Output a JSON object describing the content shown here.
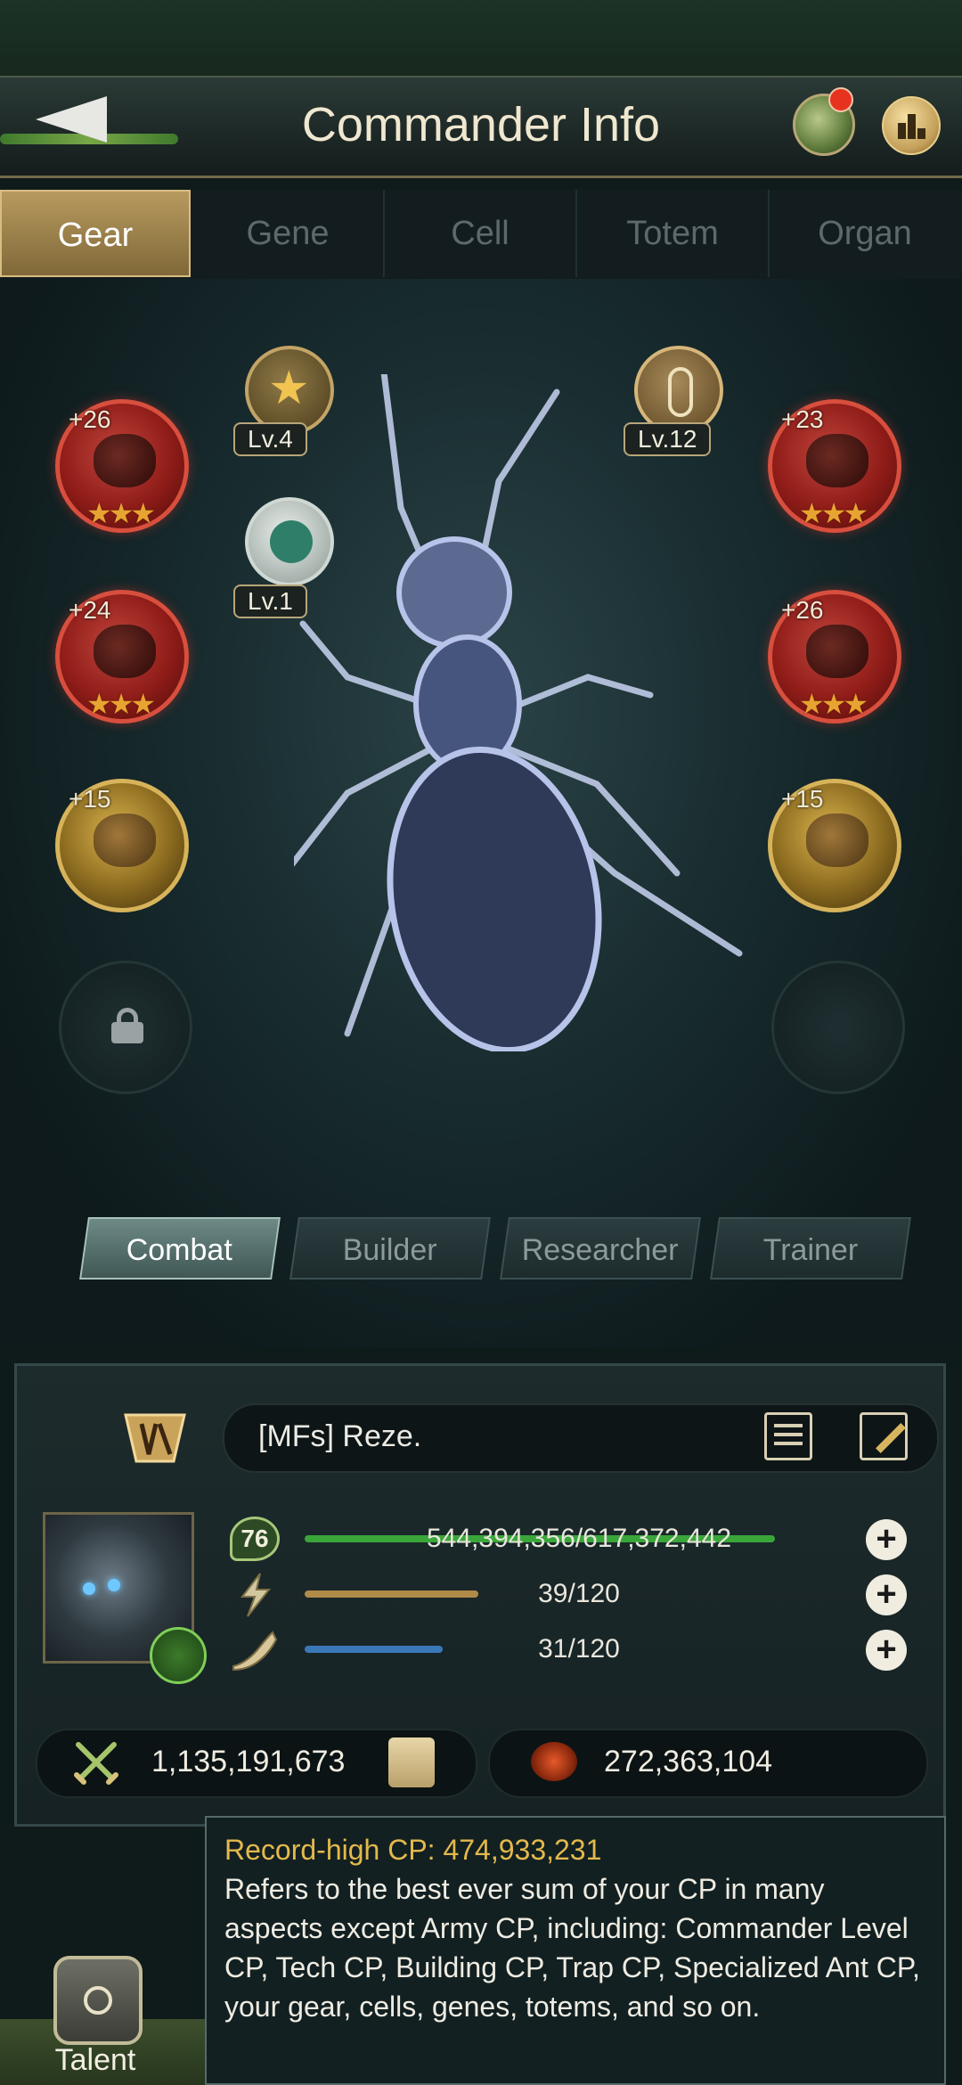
{
  "header": {
    "back_icon": "back-arrow-icon",
    "title": "Commander Info",
    "mail_icon": "mail-icon",
    "rank_icon": "rank-chart-icon"
  },
  "tabs": [
    {
      "label": "Gear",
      "active": true
    },
    {
      "label": "Gene",
      "active": false
    },
    {
      "label": "Cell",
      "active": false
    },
    {
      "label": "Totem",
      "active": false
    },
    {
      "label": "Organ",
      "active": false
    }
  ],
  "gear": {
    "slots_left": [
      {
        "plus": "+26",
        "stars": "★★★",
        "type": "red"
      },
      {
        "plus": "+24",
        "stars": "★★★",
        "type": "red"
      },
      {
        "plus": "+15",
        "stars": "",
        "type": "gold"
      }
    ],
    "slots_right": [
      {
        "plus": "+23",
        "stars": "★★★",
        "type": "red"
      },
      {
        "plus": "+26",
        "stars": "★★★",
        "type": "red"
      },
      {
        "plus": "+15",
        "stars": "",
        "type": "gold"
      }
    ],
    "medals": [
      {
        "label": "Lv.4"
      },
      {
        "label": "Lv.1"
      },
      {
        "label": "Lv.12"
      }
    ]
  },
  "roles": [
    {
      "label": "Combat",
      "active": true
    },
    {
      "label": "Builder",
      "active": false
    },
    {
      "label": "Researcher",
      "active": false
    },
    {
      "label": "Trainer",
      "active": false
    }
  ],
  "profile": {
    "name": "[MFs]  Reze.",
    "level": "76",
    "exp_text": "544,394,356/617,372,442",
    "exp_fraction": 0.88,
    "stamina_text": "39/120",
    "stamina_fraction": 0.325,
    "horn_text": "31/120",
    "horn_fraction": 0.258,
    "cp": "1,135,191,673",
    "army_cp": "272,363,104"
  },
  "tooltip": {
    "title": "Record-high CP: 474,933,231",
    "body": "Refers to the best ever sum of your CP in many aspects except Army CP, including: Commander Level CP, Tech CP, Building CP, Trap CP, Specialized Ant CP, your gear, cells, genes, totems, and so on."
  },
  "talent": {
    "label": "Talent"
  },
  "colors": {
    "exp_bar": "#3aa63a",
    "stamina_bar": "#b08a48",
    "horn_bar": "#3a78b8",
    "tooltip_title": "#e3b94c"
  }
}
